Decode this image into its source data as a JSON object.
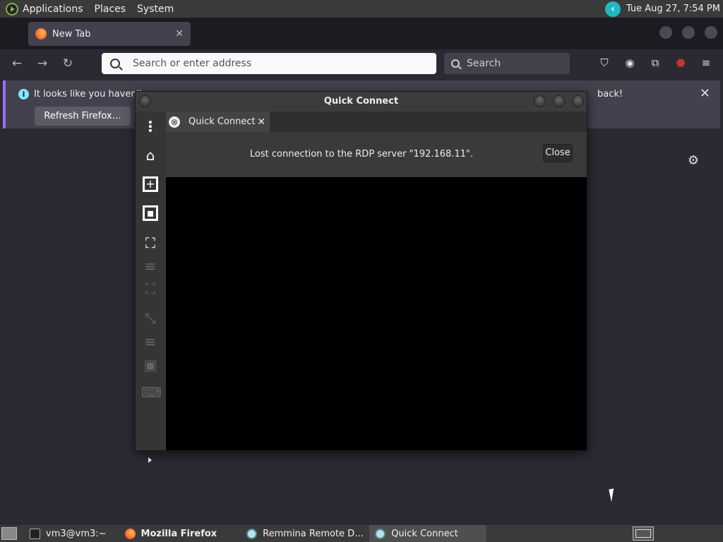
{
  "top_panel": {
    "menus": [
      "Applications",
      "Places",
      "System"
    ],
    "clock": "Tue Aug 27,  7:54 PM"
  },
  "firefox": {
    "tab_title": "New Tab",
    "url_placeholder": "Search or enter address",
    "search_placeholder": "Search",
    "notification": {
      "message_start": "It looks like you haven't s",
      "message_end": "back!",
      "refresh_button": "Refresh Firefox…"
    }
  },
  "remmina": {
    "window_title": "Quick Connect",
    "tab_label": "Quick Connect",
    "error_message": "Lost connection to the RDP server \"192.168.11\".",
    "close_button": "Close"
  },
  "taskbar": {
    "tasks": [
      {
        "label": "vm3@vm3:~",
        "active": false
      },
      {
        "label": "Mozilla Firefox",
        "active": false
      },
      {
        "label": "Remmina Remote D…",
        "active": false
      },
      {
        "label": "Quick Connect",
        "active": true
      }
    ]
  },
  "colors": {
    "firefox_bg": "#2b2a33",
    "notification_accent": "#9b6dff",
    "remmina_bg": "#2d2d2d"
  }
}
